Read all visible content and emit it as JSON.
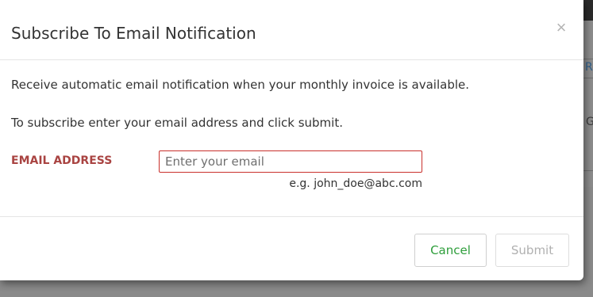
{
  "background": {
    "partial_text_top": "Re",
    "partial_text_mid": "G"
  },
  "modal": {
    "title": "Subscribe To Email Notification",
    "close_symbol": "×",
    "body": {
      "line1": "Receive automatic email notification when your monthly invoice is available.",
      "line2": "To subscribe enter your email address and click submit."
    },
    "form": {
      "email_label": "EMAIL ADDRESS",
      "email_value": "",
      "email_placeholder": "Enter your email",
      "email_hint": "e.g. john_doe@abc.com"
    },
    "footer": {
      "cancel_label": "Cancel",
      "submit_label": "Submit",
      "submit_enabled": false
    }
  },
  "colors": {
    "label_red": "#a94442",
    "input_border_red": "#c9302c",
    "cancel_green": "#2e9e3b",
    "disabled_gray": "#b0b0b0",
    "backdrop": "#7f7f7f"
  },
  "icons": {
    "close": "close-icon"
  }
}
